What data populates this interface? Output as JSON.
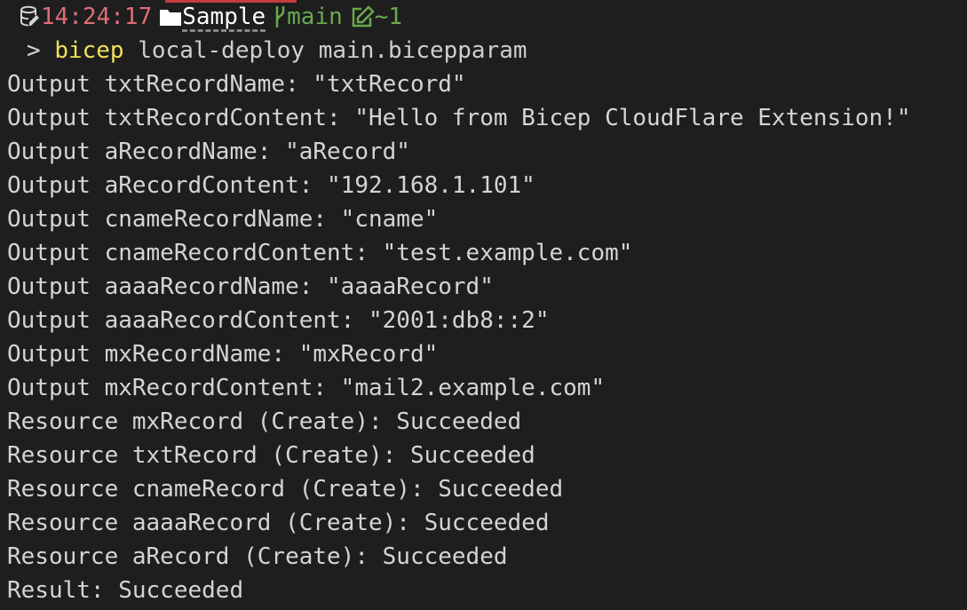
{
  "prompt": {
    "time": "14:24:17",
    "folder": "Sample",
    "branch": "main",
    "changes": "~1",
    "icons": {
      "database": "database-icon",
      "folder": "folder-icon",
      "branch": "git-branch-icon",
      "edit": "edit-icon"
    }
  },
  "command": {
    "caret": ">",
    "executable": "bicep",
    "args": "local-deploy main.bicepparam"
  },
  "output_lines": [
    "Output txtRecordName: \"txtRecord\"",
    "Output txtRecordContent: \"Hello from Bicep CloudFlare Extension!\"",
    "Output aRecordName: \"aRecord\"",
    "Output aRecordContent: \"192.168.1.101\"",
    "Output cnameRecordName: \"cname\"",
    "Output cnameRecordContent: \"test.example.com\"",
    "Output aaaaRecordName: \"aaaaRecord\"",
    "Output aaaaRecordContent: \"2001:db8::2\"",
    "Output mxRecordName: \"mxRecord\"",
    "Output mxRecordContent: \"mail2.example.com\"",
    "Resource mxRecord (Create): Succeeded",
    "Resource txtRecord (Create): Succeeded",
    "Resource cnameRecord (Create): Succeeded",
    "Resource aaaaRecord (Create): Succeeded",
    "Resource aRecord (Create): Succeeded",
    "Result: Succeeded"
  ],
  "colors": {
    "background": "#1e1e1e",
    "text": "#d4d4d4",
    "time": "#e06c75",
    "git": "#6aa84f",
    "executable": "#f1e05a"
  }
}
